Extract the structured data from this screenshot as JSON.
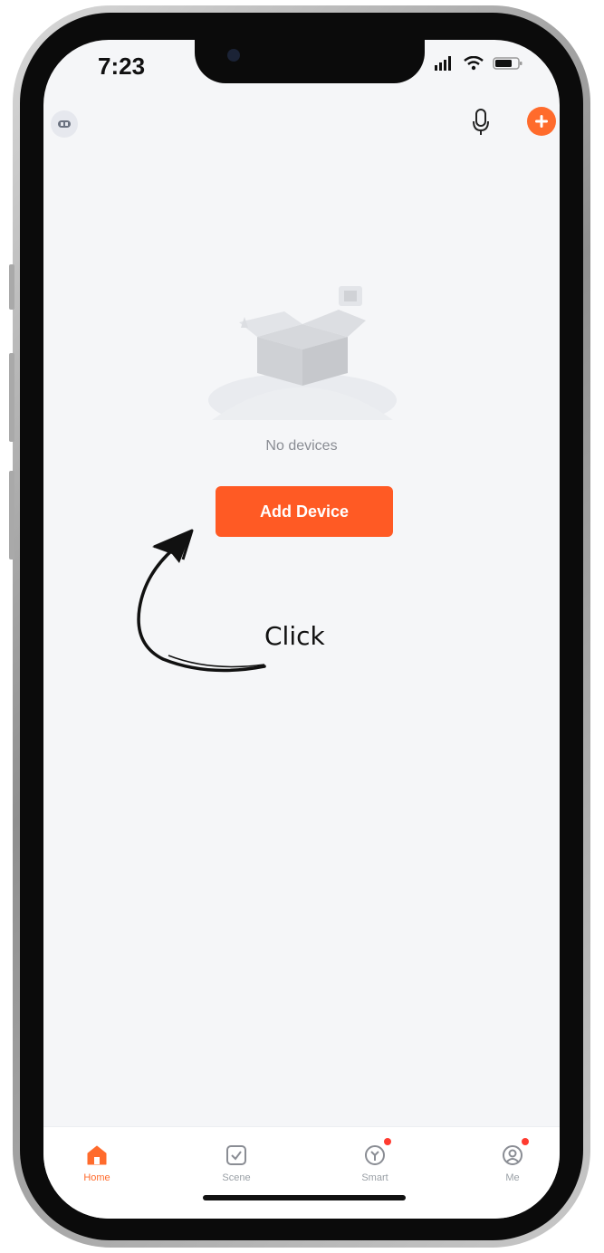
{
  "status_bar": {
    "time": "7:23"
  },
  "header": {
    "left_icon": "profile-icon",
    "mic_icon": "microphone-icon",
    "add_icon": "plus-icon",
    "accent": "#ff6b2c"
  },
  "main": {
    "empty_text": "No devices",
    "add_device_label": "Add Device",
    "annotation": "Click"
  },
  "tabs": [
    {
      "label": "Home",
      "icon": "home-icon",
      "active": true
    },
    {
      "label": "Scene",
      "icon": "scene-icon",
      "active": false
    },
    {
      "label": "Smart",
      "icon": "smart-icon",
      "active": false,
      "badge": true
    },
    {
      "label": "Me",
      "icon": "me-icon",
      "active": false,
      "badge": true
    }
  ]
}
